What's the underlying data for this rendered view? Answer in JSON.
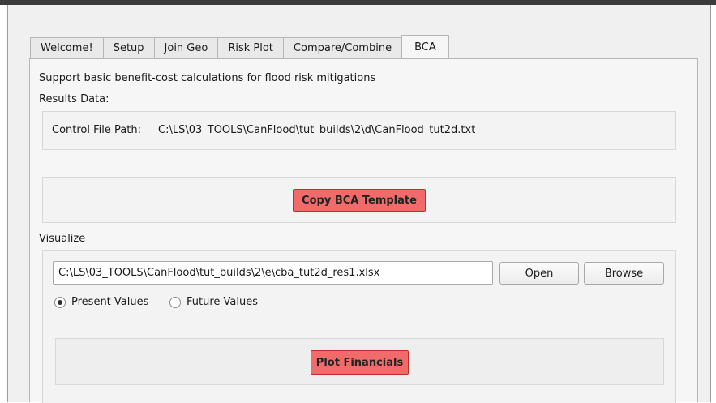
{
  "tabs": [
    {
      "label": "Welcome!",
      "active": false
    },
    {
      "label": "Setup",
      "active": false
    },
    {
      "label": "Join Geo",
      "active": false
    },
    {
      "label": "Risk Plot",
      "active": false
    },
    {
      "label": "Compare/Combine",
      "active": false
    },
    {
      "label": "BCA",
      "active": true
    }
  ],
  "bca": {
    "description": "Support basic benefit-cost calculations for flood risk mitigations",
    "results_label": "Results Data:",
    "control_file_label": "Control File Path:",
    "control_file_path": "C:\\LS\\03_TOOLS\\CanFlood\\tut_builds\\2\\d\\CanFlood_tut2d.txt",
    "copy_template_label": "Copy BCA Template",
    "visualize_label": "Visualize",
    "file_input_value": "C:\\LS\\03_TOOLS\\CanFlood\\tut_builds\\2\\e\\cba_tut2d_res1.xlsx",
    "open_label": "Open",
    "browse_label": "Browse",
    "radio_present_label": "Present Values",
    "radio_future_label": "Future Values",
    "selected_radio": "present",
    "plot_financials_label": "Plot Financials"
  },
  "colors": {
    "accent_button": "#f26b6b",
    "accent_border": "#c22b2b"
  }
}
